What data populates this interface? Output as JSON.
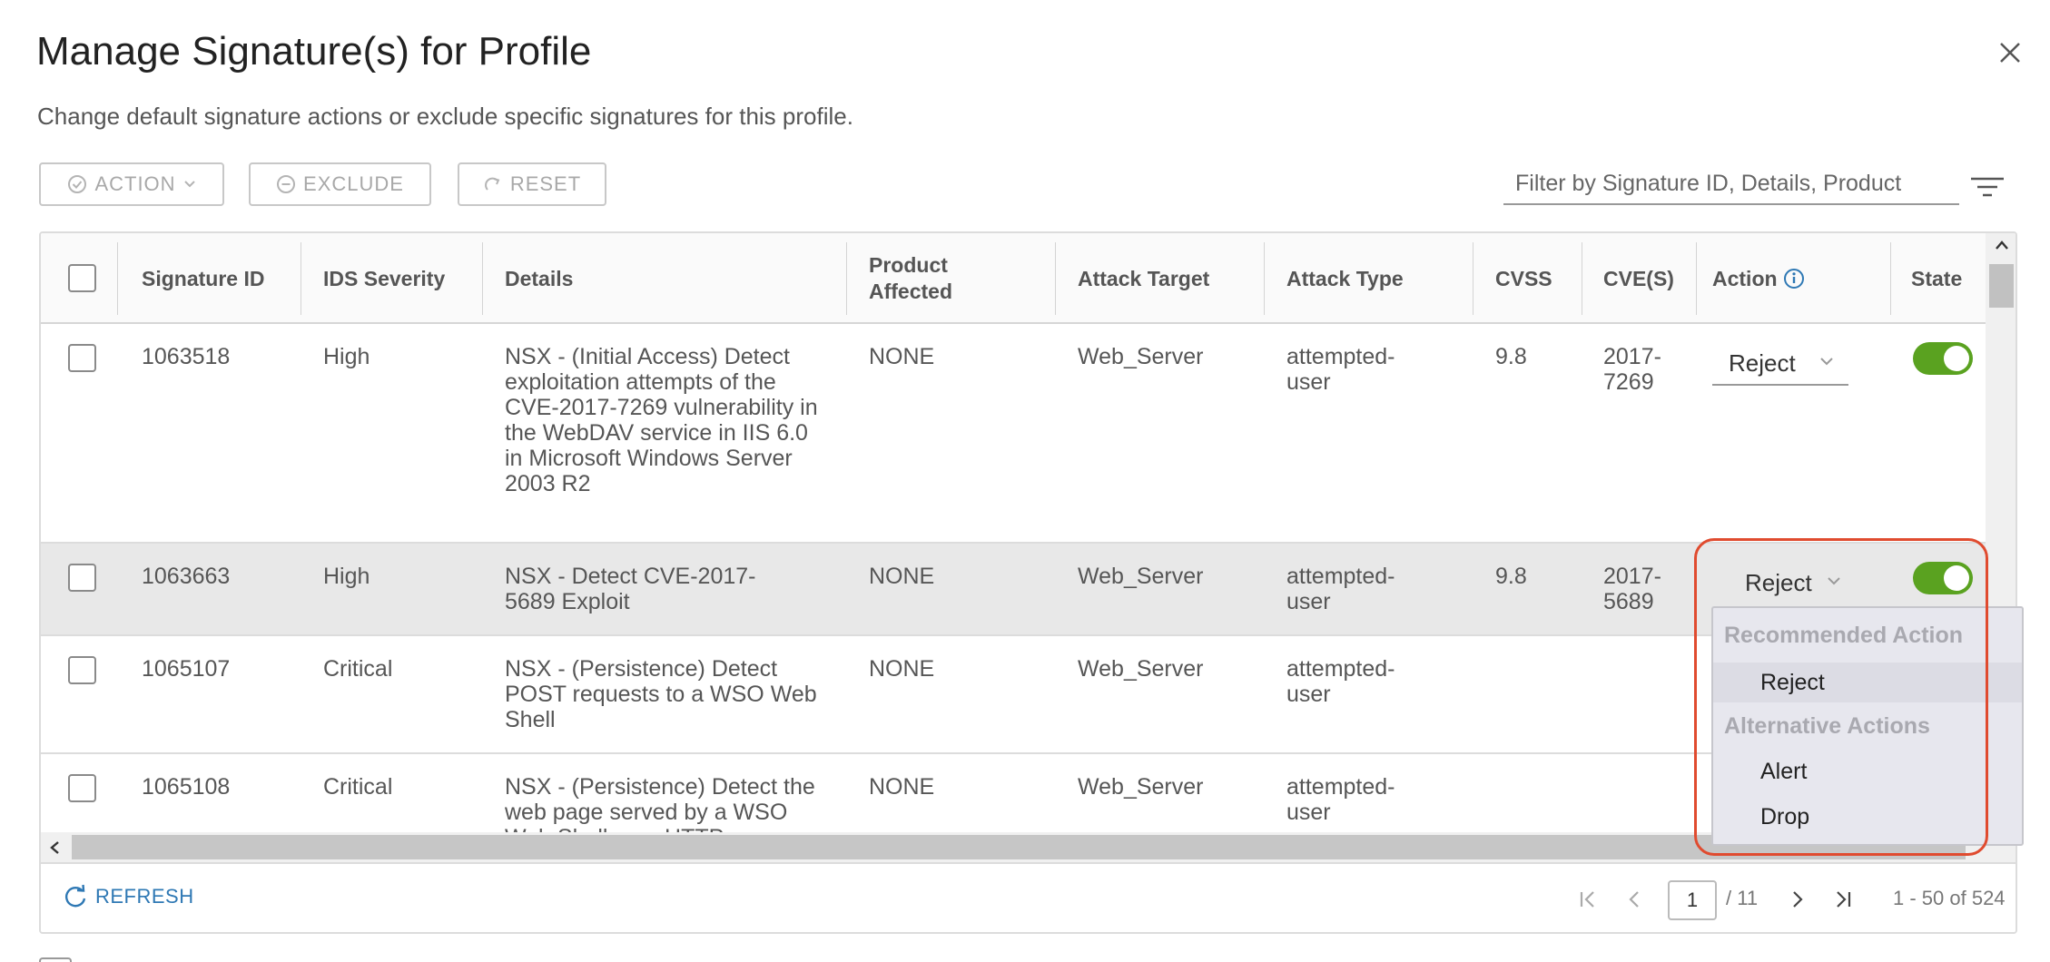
{
  "dialog": {
    "title": "Manage Signature(s) for Profile",
    "subtitle": "Change default signature actions or exclude specific signatures for this profile."
  },
  "toolbar": {
    "action_label": "ACTION",
    "exclude_label": "EXCLUDE",
    "reset_label": "RESET",
    "filter_placeholder": "Filter by Signature ID, Details, Product"
  },
  "table": {
    "columns": {
      "signature_id": "Signature ID",
      "ids_severity": "IDS Severity",
      "details": "Details",
      "product_affected_1": "Product",
      "product_affected_2": "Affected",
      "attack_target": "Attack Target",
      "attack_type": "Attack Type",
      "cvss": "CVSS",
      "cves": "CVE(S)",
      "action": "Action",
      "state": "State"
    },
    "rows": [
      {
        "id": "1063518",
        "severity": "High",
        "details": "NSX - (Initial Access) Detect exploitation attempts of the CVE-2017-7269 vulnerability in the WebDAV service in IIS 6.0 in Microsoft Windows Server 2003 R2",
        "product": "NONE",
        "target": "Web_Server",
        "attack_type": "attempted-user",
        "cvss": "9.8",
        "cve": "2017-7269",
        "action": "Reject",
        "state": "on"
      },
      {
        "id": "1063663",
        "severity": "High",
        "details": "NSX - Detect CVE-2017-5689 Exploit",
        "product": "NONE",
        "target": "Web_Server",
        "attack_type": "attempted-user",
        "cvss": "9.8",
        "cve": "2017-5689",
        "action": "Reject",
        "state": "on"
      },
      {
        "id": "1065107",
        "severity": "Critical",
        "details": "NSX - (Persistence) Detect POST requests to a WSO Web Shell",
        "product": "NONE",
        "target": "Web_Server",
        "attack_type": "attempted-user",
        "cvss": "",
        "cve": ""
      },
      {
        "id": "1065108",
        "severity": "Critical",
        "details": "NSX - (Persistence) Detect the web page served by a WSO Web Shell over HTTP",
        "product": "NONE",
        "target": "Web_Server",
        "attack_type": "attempted-user",
        "cvss": "",
        "cve": ""
      }
    ]
  },
  "dropdown": {
    "recommended_header": "Recommended Action",
    "recommended": [
      "Reject"
    ],
    "alternative_header": "Alternative Actions",
    "alternatives": [
      "Alert",
      "Drop"
    ]
  },
  "footer": {
    "refresh_label": "REFRESH",
    "current_page": "1",
    "total_pages": "/ 11",
    "range": "1 - 50 of 524"
  },
  "colors": {
    "toggle_on": "#5aa220",
    "link": "#2e78b4",
    "callout": "#e04b2f"
  }
}
